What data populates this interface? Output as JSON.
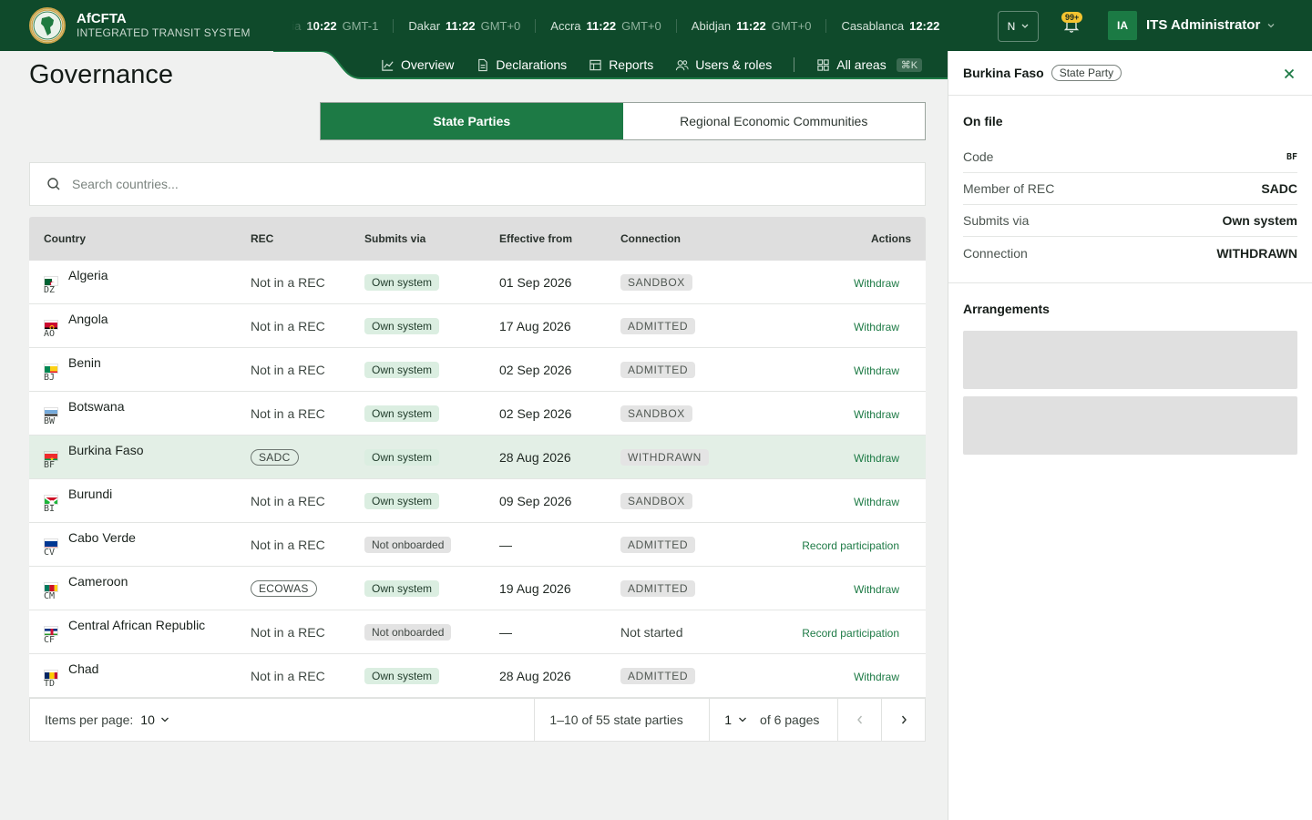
{
  "app": {
    "name": "AfCFTA",
    "subtitle": "INTEGRATED TRANSIT SYSTEM"
  },
  "clocks": [
    {
      "city": "Praia",
      "time": "10:22",
      "zone": "GMT-1"
    },
    {
      "city": "Dakar",
      "time": "11:22",
      "zone": "GMT+0"
    },
    {
      "city": "Accra",
      "time": "11:22",
      "zone": "GMT+0"
    },
    {
      "city": "Abidjan",
      "time": "11:22",
      "zone": "GMT+0"
    },
    {
      "city": "Casablanca",
      "time": "12:22",
      "zone": ""
    }
  ],
  "header": {
    "language": "N",
    "notification_badge": "99+",
    "user_initials": "IA",
    "user_name": "ITS Administrator"
  },
  "nav": {
    "overview": "Overview",
    "declarations": "Declarations",
    "reports": "Reports",
    "users_roles": "Users & roles",
    "all_areas": "All areas",
    "shortcut": "⌘K"
  },
  "page": {
    "title": "Governance"
  },
  "toggle": {
    "state_parties": "State Parties",
    "recs": "Regional Economic Communities"
  },
  "search": {
    "placeholder": "Search countries..."
  },
  "table": {
    "headers": {
      "country": "Country",
      "rec": "REC",
      "submits_via": "Submits via",
      "effective_from": "Effective from",
      "connection": "Connection",
      "actions": "Actions"
    },
    "rows": [
      {
        "name": "Algeria",
        "code": "DZ",
        "rec": "Not in a REC",
        "rec_tag": false,
        "via": "Own system",
        "via_onboarded": true,
        "date": "01 Sep 2026",
        "conn": "SANDBOX",
        "conn_pill": true,
        "action": "Withdraw",
        "selected": false
      },
      {
        "name": "Angola",
        "code": "AO",
        "rec": "Not in a REC",
        "rec_tag": false,
        "via": "Own system",
        "via_onboarded": true,
        "date": "17 Aug 2026",
        "conn": "ADMITTED",
        "conn_pill": true,
        "action": "Withdraw",
        "selected": false
      },
      {
        "name": "Benin",
        "code": "BJ",
        "rec": "Not in a REC",
        "rec_tag": false,
        "via": "Own system",
        "via_onboarded": true,
        "date": "02 Sep 2026",
        "conn": "ADMITTED",
        "conn_pill": true,
        "action": "Withdraw",
        "selected": false
      },
      {
        "name": "Botswana",
        "code": "BW",
        "rec": "Not in a REC",
        "rec_tag": false,
        "via": "Own system",
        "via_onboarded": true,
        "date": "02 Sep 2026",
        "conn": "SANDBOX",
        "conn_pill": true,
        "action": "Withdraw",
        "selected": false
      },
      {
        "name": "Burkina Faso",
        "code": "BF",
        "rec": "SADC",
        "rec_tag": true,
        "via": "Own system",
        "via_onboarded": true,
        "date": "28 Aug 2026",
        "conn": "WITHDRAWN",
        "conn_pill": true,
        "action": "Withdraw",
        "selected": true
      },
      {
        "name": "Burundi",
        "code": "BI",
        "rec": "Not in a REC",
        "rec_tag": false,
        "via": "Own system",
        "via_onboarded": true,
        "date": "09 Sep 2026",
        "conn": "SANDBOX",
        "conn_pill": true,
        "action": "Withdraw",
        "selected": false
      },
      {
        "name": "Cabo Verde",
        "code": "CV",
        "rec": "Not in a REC",
        "rec_tag": false,
        "via": "Not onboarded",
        "via_onboarded": false,
        "date": "—",
        "conn": "ADMITTED",
        "conn_pill": true,
        "action": "Record participation",
        "selected": false
      },
      {
        "name": "Cameroon",
        "code": "CM",
        "rec": "ECOWAS",
        "rec_tag": true,
        "via": "Own system",
        "via_onboarded": true,
        "date": "19 Aug 2026",
        "conn": "ADMITTED",
        "conn_pill": true,
        "action": "Withdraw",
        "selected": false
      },
      {
        "name": "Central African Republic",
        "code": "CF",
        "rec": "Not in a REC",
        "rec_tag": false,
        "via": "Not onboarded",
        "via_onboarded": false,
        "date": "—",
        "conn": "Not started",
        "conn_pill": false,
        "action": "Record participation",
        "selected": false
      },
      {
        "name": "Chad",
        "code": "TD",
        "rec": "Not in a REC",
        "rec_tag": false,
        "via": "Own system",
        "via_onboarded": true,
        "date": "28 Aug 2026",
        "conn": "ADMITTED",
        "conn_pill": true,
        "action": "Withdraw",
        "selected": false
      }
    ]
  },
  "pagination": {
    "items_per_page_label": "Items per page:",
    "items_per_page": "10",
    "range": "1–10 of 55 state parties",
    "page": "1",
    "of_pages": "of 6 pages"
  },
  "panel": {
    "title": "Burkina Faso",
    "tag": "State Party",
    "on_file_title": "On file",
    "fields": [
      {
        "label": "Code",
        "value": "BF"
      },
      {
        "label": "Member of REC",
        "value": "SADC"
      },
      {
        "label": "Submits via",
        "value": "Own system"
      },
      {
        "label": "Connection",
        "value": "WITHDRAWN"
      }
    ],
    "arrangements_title": "Arrangements"
  },
  "colors": {
    "brand_dark": "#0f4a2b",
    "brand_green": "#1d7a45",
    "selected_row": "#e3efe6",
    "badge": "#f4c430"
  }
}
